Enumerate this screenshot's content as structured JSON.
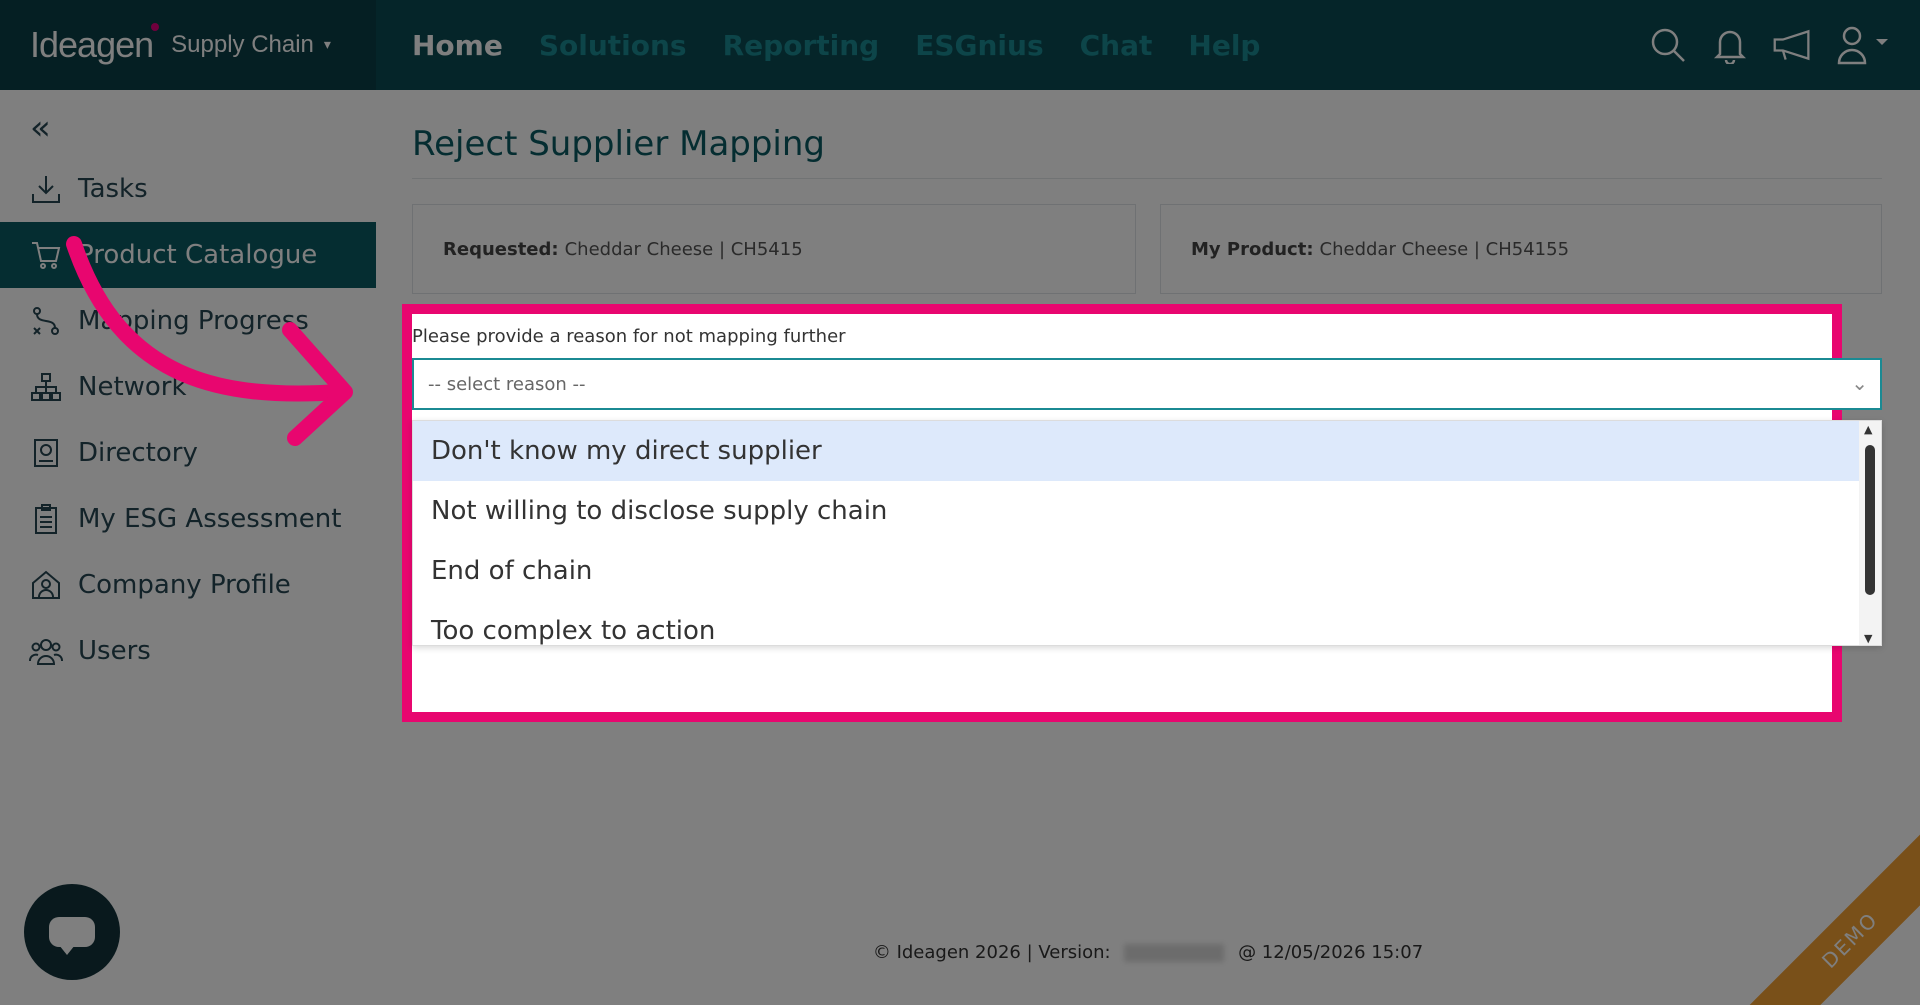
{
  "brand": {
    "logo": "Ideagen",
    "product": "Supply Chain",
    "caret": "▾"
  },
  "nav": [
    {
      "label": "Home",
      "active": true
    },
    {
      "label": "Solutions"
    },
    {
      "label": "Reporting"
    },
    {
      "label": "ESGnius"
    },
    {
      "label": "Chat"
    },
    {
      "label": "Help"
    }
  ],
  "top_icons": [
    "search-icon",
    "bell-icon",
    "megaphone-icon",
    "user-icon"
  ],
  "sidebar": {
    "collapse": "«",
    "items": [
      {
        "label": "Tasks",
        "icon": "download-tray-icon"
      },
      {
        "label": "Product Catalogue",
        "icon": "cart-icon",
        "active": true
      },
      {
        "label": "Mapping Progress",
        "icon": "route-icon"
      },
      {
        "label": "Network",
        "icon": "hierarchy-icon"
      },
      {
        "label": "Directory",
        "icon": "book-icon"
      },
      {
        "label": "My ESG Assessment",
        "icon": "clipboard-icon"
      },
      {
        "label": "Company Profile",
        "icon": "building-icon"
      },
      {
        "label": "Users",
        "icon": "users-icon"
      }
    ]
  },
  "main": {
    "title": "Reject Supplier Mapping",
    "requested": {
      "label": "Requested:",
      "value": "Cheddar Cheese | CH5415"
    },
    "my_product": {
      "label": "My Product:",
      "value": "Cheddar Cheese | CH54155"
    },
    "reason": {
      "label": "Please provide a reason for not mapping further",
      "placeholder": "-- select reason --",
      "options": [
        "Don't know my direct supplier",
        "Not willing to disclose supply chain",
        "End of chain",
        "Too complex to action"
      ],
      "highlighted_index": 0
    }
  },
  "footer": {
    "left": "© Ideagen 2026 | Version:",
    "right": "@ 12/05/2026 15:07"
  },
  "demo_ribbon": "DEMO",
  "colors": {
    "nav_bg": "#0a4a52",
    "accent": "#1b8a93",
    "highlight": "#e8066f",
    "ribbon": "#f2a033"
  }
}
